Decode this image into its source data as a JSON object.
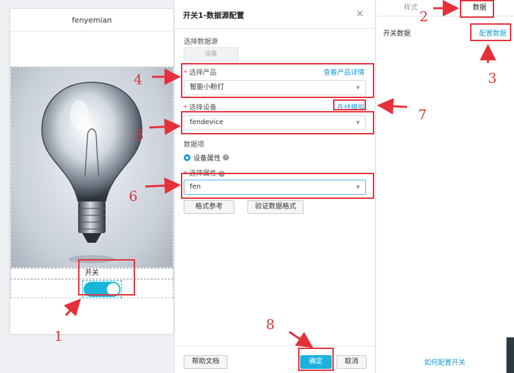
{
  "preview": {
    "title": "fenyemian",
    "switch_label": "开关",
    "switch_state": "on",
    "image": "light-bulb-photo"
  },
  "dialog": {
    "title": "开关1-数据源配置",
    "close": "×",
    "data_source_label": "选择数据源",
    "data_source_button": "设备",
    "product_label": "选择产品",
    "product_link": "查看产品详情",
    "product_value": "智能小粉灯",
    "device_label": "选择设备",
    "device_link": "在线模拟",
    "device_value": "fendevice",
    "data_item_label": "数据项",
    "radio_label": "设备属性",
    "attr_label": "选择属性",
    "attr_value": "fen",
    "format_btn": "格式参考",
    "verify_btn": "验证数据格式",
    "help_btn": "帮助文档",
    "ok_btn": "确定",
    "cancel_btn": "取消"
  },
  "right_panel": {
    "tabs": [
      "样式",
      "数据"
    ],
    "active_tab": "数据",
    "switch_data_label": "开关数据",
    "config_link": "配置数据",
    "howto_link": "如何配置开关"
  },
  "annotations": [
    "1",
    "2",
    "3",
    "4",
    "5",
    "6",
    "7",
    "8"
  ],
  "colors": {
    "accent": "#1a9bd7",
    "primary_button": "#1db2dd",
    "annotation": "#e5303a"
  }
}
